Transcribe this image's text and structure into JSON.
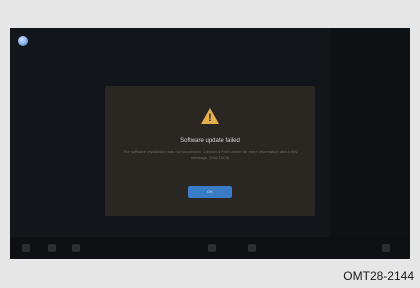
{
  "dialog": {
    "title": "Software update failed",
    "message": "The software installation was not successful. Contact a Ford dealer for more information about this message. (EA2T4C8)",
    "ok_label": "OK"
  },
  "caption": "OMT28-2144",
  "colors": {
    "screen_bg": "#121519",
    "dialog_bg": "#2a2622",
    "warning": "#e3b04b",
    "button": "#3a7bc7"
  },
  "icons": {
    "corner": "profile-icon",
    "warning": "warning-triangle-icon"
  }
}
